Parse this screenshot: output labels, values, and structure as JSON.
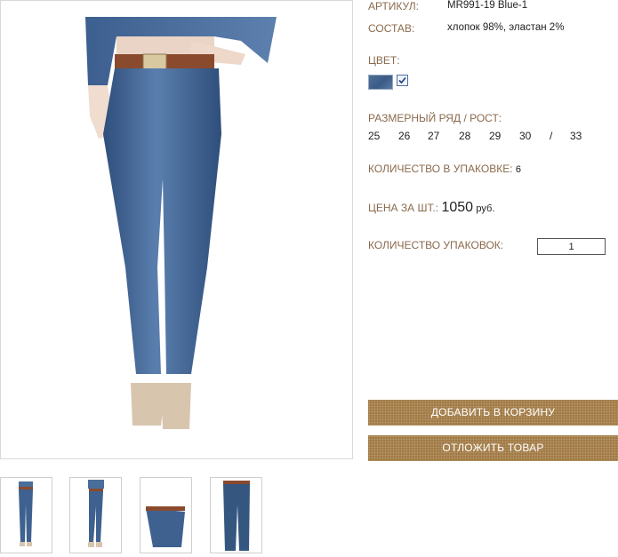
{
  "product": {
    "article_label": "АРТИКУЛ:",
    "article_value": "MR991-19 Blue-1",
    "composition_label": "СОСТАВ:",
    "composition_value": "хлопок 98%, эластан 2%",
    "color_label": "ЦВЕТ:",
    "color_swatch": "#45678f",
    "size_label": "РАЗМЕРНЫЙ РЯД / РОСТ:",
    "sizes": [
      "25",
      "26",
      "27",
      "28",
      "29",
      "30",
      "/",
      "33"
    ],
    "pack_qty_label": "КОЛИЧЕСТВО В УПАКОВКЕ:",
    "pack_qty_value": "6",
    "price_label": "ЦЕНА ЗА ШТ.:",
    "price_value": "1050",
    "price_currency": "руб.",
    "packs_label": "КОЛИЧЕСТВО УПАКОВОК:",
    "packs_value": "1"
  },
  "buttons": {
    "add_to_cart": "ДОБАВИТЬ В КОРЗИНУ",
    "defer": "ОТЛОЖИТЬ ТОВАР"
  },
  "colors": {
    "label": "#8a6a4c",
    "button": "#a07a47",
    "denim": "#45678f"
  }
}
